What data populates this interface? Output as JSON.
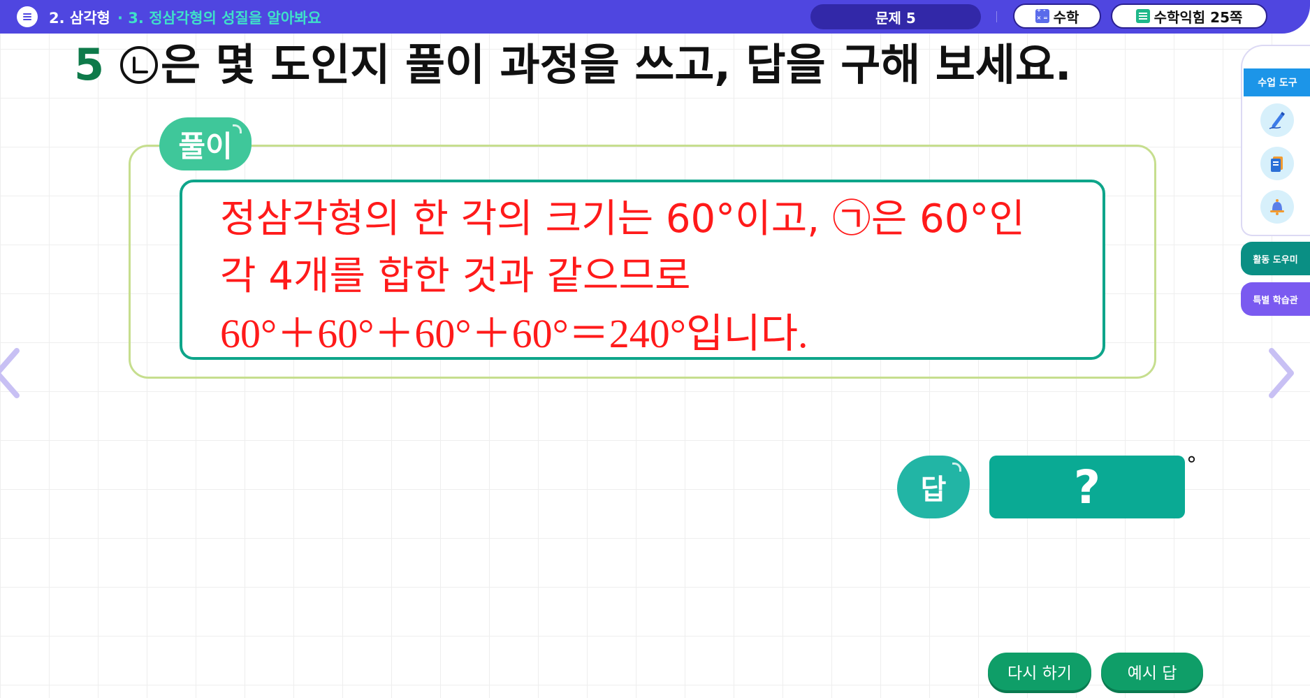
{
  "header": {
    "unit": "2. 삼각형",
    "lesson": "· 3. 정삼각형의 성질을 알아봐요",
    "problem": "문제 5",
    "subject": "수학",
    "book": "수학익힘 25쪽"
  },
  "question": {
    "number": "5",
    "text": "은 몇 도인지 풀이 과정을 쓰고, 답을 구해 보세요."
  },
  "solution": {
    "label": "풀이",
    "line1": "정삼각형의 한 각의 크기는 60°이고, ㉠은 60°인",
    "line2": "각 4개를 합한 것과 같으므로",
    "line3": "60°＋60°＋60°＋60°＝240°입니다."
  },
  "answer": {
    "label": "답",
    "placeholder": "?",
    "unit": "°"
  },
  "tools": {
    "title": "수업 도구",
    "activity_helper": "활동 도우미",
    "special_lab": "특별 학습관"
  },
  "buttons": {
    "retry": "다시 하기",
    "example": "예시 답"
  },
  "colors": {
    "header_bg": "#4f46e0",
    "lesson_text": "#3fe0c9",
    "solution_text": "#ff1a1a",
    "answer_box": "#0aaa94",
    "activity_tab": "#0a8f84",
    "special_tab": "#7a5af0",
    "bottom_button": "#0f9e68"
  },
  "icons": {
    "menu": "menu-icon",
    "pen": "pen-icon",
    "book": "book-icon",
    "bell": "bell-icon",
    "prev": "chevron-left-icon",
    "next": "chevron-right-icon"
  }
}
